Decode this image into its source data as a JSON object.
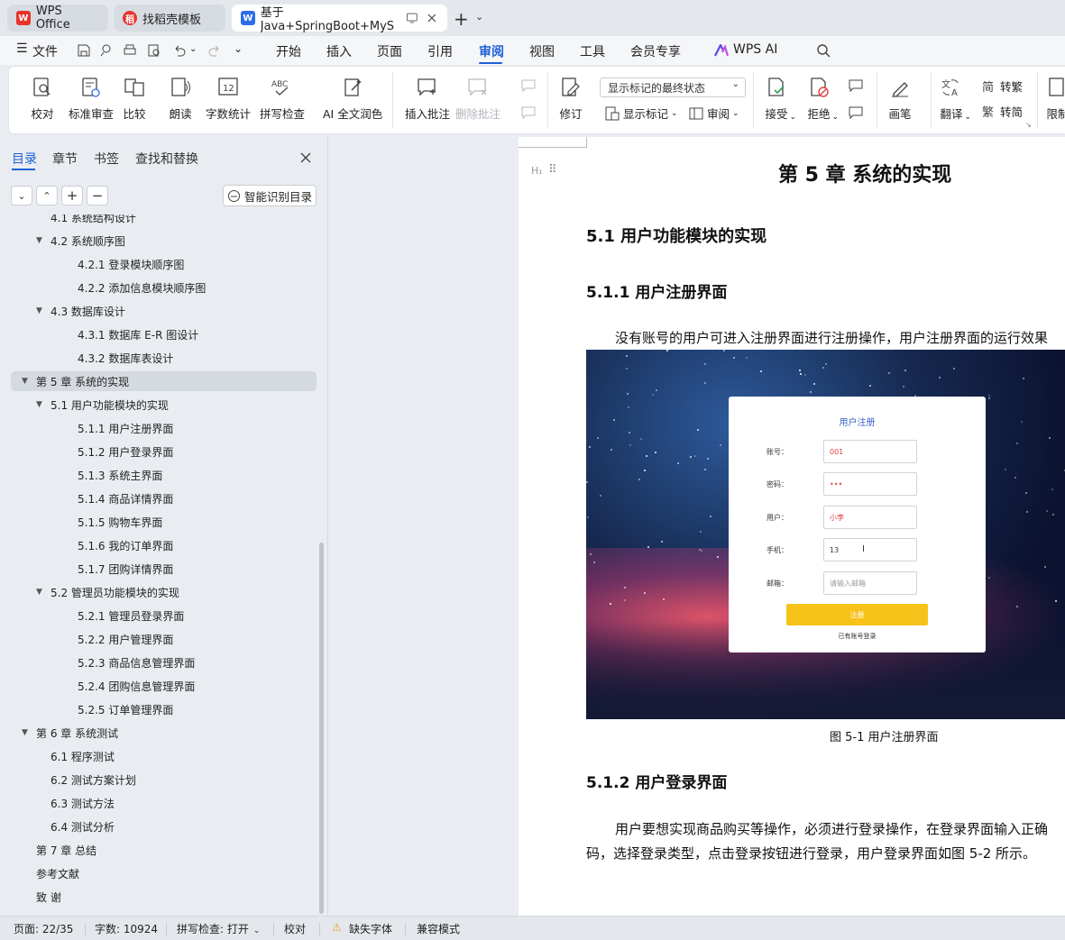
{
  "tabs": [
    {
      "label": "WPS Office",
      "icon": "wps-logo-icon"
    },
    {
      "label": "找稻壳模板",
      "icon": "docer-icon"
    },
    {
      "label": "基于Java+SpringBoot+MyS",
      "icon": "word-doc-icon"
    }
  ],
  "menu": {
    "file": "文件",
    "items": [
      "开始",
      "插入",
      "页面",
      "引用",
      "审阅",
      "视图",
      "工具",
      "会员专享",
      "WPS AI"
    ],
    "active": "审阅"
  },
  "ribbon": {
    "proofread": "校对",
    "standard_review": "标准审查",
    "compare": "比较",
    "read_aloud": "朗读",
    "word_count": "字数统计",
    "spell_check": "拼写检查",
    "ai_polish": "AI 全文润色",
    "insert_comment": "插入批注",
    "delete_comment": "删除批注",
    "track_changes": "修订",
    "markup_state": "显示标记的最终状态",
    "show_markup": "显示标记",
    "review": "审阅",
    "accept": "接受",
    "reject": "拒绝",
    "pen": "画笔",
    "translate": "翻译",
    "to_traditional": "转繁",
    "to_simplified": "转简",
    "restrict": "限制"
  },
  "panel": {
    "tabs": [
      "目录",
      "章节",
      "书签",
      "查找和替换"
    ],
    "smart_toc": "智能识别目录"
  },
  "toc": [
    {
      "text": "4.1  系统结构设计",
      "level": 2,
      "caret": false
    },
    {
      "text": "4.2 系统顺序图",
      "level": 2,
      "caret": true
    },
    {
      "text": "4.2.1 登录模块顺序图",
      "level": 3,
      "caret": false
    },
    {
      "text": "4.2.2 添加信息模块顺序图",
      "level": 3,
      "caret": false
    },
    {
      "text": "4.3  数据库设计",
      "level": 2,
      "caret": true
    },
    {
      "text": "4.3.1  数据库 E-R 图设计",
      "level": 3,
      "caret": false
    },
    {
      "text": "4.3.2 数据库表设计",
      "level": 3,
      "caret": false
    },
    {
      "text": "第 5 章    系统的实现",
      "level": 1,
      "caret": true,
      "selected": true
    },
    {
      "text": "5.1  用户功能模块的实现",
      "level": 2,
      "caret": true
    },
    {
      "text": "5.1.1 用户注册界面",
      "level": 3,
      "caret": false
    },
    {
      "text": "5.1.2 用户登录界面",
      "level": 3,
      "caret": false
    },
    {
      "text": "5.1.3 系统主界面",
      "level": 3,
      "caret": false
    },
    {
      "text": "5.1.4 商品详情界面",
      "level": 3,
      "caret": false
    },
    {
      "text": "5.1.5 购物车界面",
      "level": 3,
      "caret": false
    },
    {
      "text": "5.1.6 我的订单界面",
      "level": 3,
      "caret": false
    },
    {
      "text": "5.1.7 团购详情界面",
      "level": 3,
      "caret": false
    },
    {
      "text": "5.2  管理员功能模块的实现",
      "level": 2,
      "caret": true
    },
    {
      "text": "5.2.1 管理员登录界面",
      "level": 3,
      "caret": false
    },
    {
      "text": "5.2.2 用户管理界面",
      "level": 3,
      "caret": false
    },
    {
      "text": "5.2.3 商品信息管理界面",
      "level": 3,
      "caret": false
    },
    {
      "text": "5.2.4 团购信息管理界面",
      "level": 3,
      "caret": false
    },
    {
      "text": "5.2.5 订单管理界面",
      "level": 3,
      "caret": false
    },
    {
      "text": "第 6 章  系统测试",
      "level": 1,
      "caret": true
    },
    {
      "text": "6.1  程序测试",
      "level": 2,
      "caret": false
    },
    {
      "text": "6.2  测试方案计划",
      "level": 2,
      "caret": false
    },
    {
      "text": "6.3  测试方法",
      "level": 2,
      "caret": false
    },
    {
      "text": "6.4  测试分析",
      "level": 2,
      "caret": false
    },
    {
      "text": "第 7 章  总结",
      "level": 1,
      "caret": false
    },
    {
      "text": "参考文献",
      "level": 1,
      "caret": false
    },
    {
      "text": "致    谢",
      "level": 1,
      "caret": false
    }
  ],
  "doc": {
    "chapter_title": "第 5 章    系统的实现",
    "h_51": "5.1  用户功能模块的实现",
    "h_511": "5.1.1 用户注册界面",
    "para_1": "没有账号的用户可进入注册界面进行注册操作，用户注册界面的运行效果",
    "figure_caption": "图 5-1  用户注册界面",
    "h_512": "5.1.2 用户登录界面",
    "para_2a": "用户要想实现商品购买等操作，必须进行登录操作，在登录界面输入正确",
    "para_2b": "码，选择登录类型，点击登录按钮进行登录，用户登录界面如图 5-2 所示。"
  },
  "register_form": {
    "title": "用户注册",
    "fields": [
      {
        "label": "账号：",
        "value": "001",
        "placeholder": false
      },
      {
        "label": "密码：",
        "value": "•••",
        "placeholder": false
      },
      {
        "label": "用户：",
        "value": "小李",
        "placeholder": false
      },
      {
        "label": "手机：",
        "value": "13",
        "placeholder": false
      },
      {
        "label": "邮箱：",
        "value": "请输入邮箱",
        "placeholder": true
      }
    ],
    "button": "注册",
    "link": "已有账号登录"
  },
  "status": {
    "page": "页面: 22/35",
    "words": "字数: 10924",
    "spell": "拼写检查: 打开",
    "proof": "校对",
    "missing_font": "缺失字体",
    "compat": "兼容模式"
  }
}
